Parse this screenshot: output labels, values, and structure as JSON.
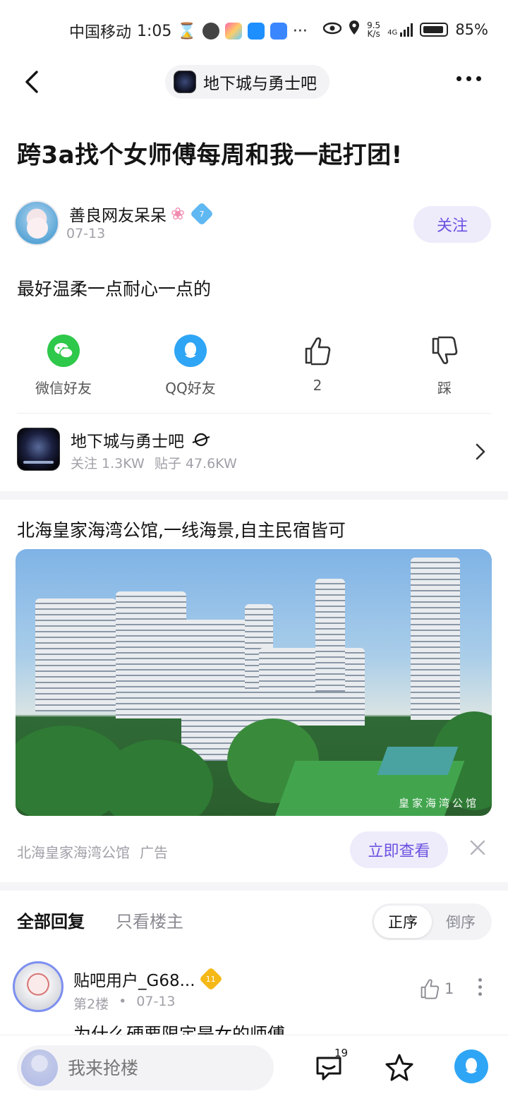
{
  "status_bar": {
    "carrier": "中国移动",
    "time": "1:05",
    "net_speed_value": "9.5",
    "net_speed_unit": "K/s",
    "network_type": "4G",
    "battery": "85%"
  },
  "nav": {
    "forum_name": "地下城与勇士吧"
  },
  "post": {
    "title": "跨3a找个女师傅每周和我一起打团!",
    "author": "善良网友呆呆",
    "author_level": "7",
    "date": "07-13",
    "follow_label": "关注",
    "body": "最好温柔一点耐心一点的"
  },
  "share": {
    "wechat_label": "微信好友",
    "qq_label": "QQ好友",
    "like_count": "2",
    "dislike_label": "踩"
  },
  "forum_card": {
    "name": "地下城与勇士吧",
    "followers": "关注 1.3KW",
    "posts": "贴子 47.6KW"
  },
  "ad": {
    "title": "北海皇家海湾公馆,一线海景,自主民宿皆可",
    "watermark": "皇家海湾公馆",
    "source": "北海皇家海湾公馆",
    "ad_label": "广告",
    "button_label": "立即查看"
  },
  "replies": {
    "tab_all": "全部回复",
    "tab_owner": "只看楼主",
    "sort_asc": "正序",
    "sort_desc": "倒序",
    "items": [
      {
        "user": "贴吧用户_G68...",
        "level": "11",
        "floor": "第2楼",
        "date": "07-13",
        "likes": "1",
        "text": "为什么硬要限定是女的师傅"
      }
    ]
  },
  "bottom_bar": {
    "input_placeholder": "我来抢楼",
    "comment_count": "19"
  },
  "colors": {
    "accent": "#6c52e0",
    "accent_bg": "#eeebfb",
    "wechat": "#2ec84a",
    "qq": "#2fa5f5"
  }
}
